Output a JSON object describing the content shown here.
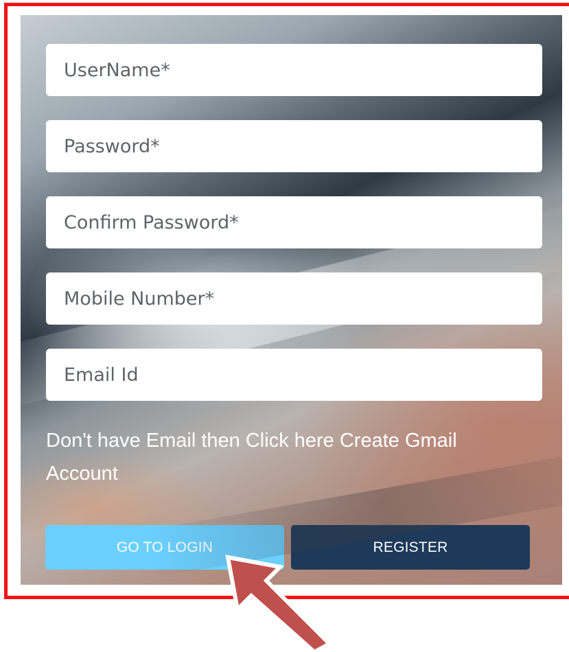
{
  "form": {
    "username_placeholder": "UserName*",
    "password_placeholder": "Password*",
    "confirm_password_placeholder": "Confirm Password*",
    "mobile_placeholder": "Mobile Number*",
    "email_placeholder": "Email Id",
    "helper_text": "Don't have Email then Click here Create Gmail Account"
  },
  "buttons": {
    "login_label": "GO TO LOGIN",
    "register_label": "REGISTER"
  },
  "colors": {
    "highlight_border": "#f01414",
    "login_button": "#6bd0ff",
    "register_button": "#1e3a5a",
    "annotation_arrow": "#c0504d"
  },
  "annotations": {
    "arrow_icon": "arrow-pointing-up-left-icon"
  }
}
